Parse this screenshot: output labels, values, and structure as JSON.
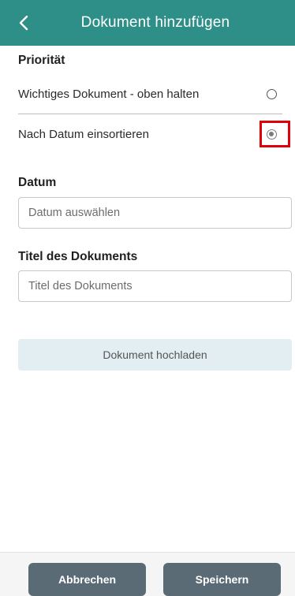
{
  "header": {
    "title": "Dokument hinzufügen",
    "back_icon": "chevron-left-icon",
    "background_color": "#2e8f89"
  },
  "priority": {
    "title": "Priorität",
    "options": [
      {
        "label": "Wichtiges Dokument - oben halten",
        "selected": false
      },
      {
        "label": "Nach Datum einsortieren",
        "selected": true
      }
    ]
  },
  "date": {
    "title": "Datum",
    "placeholder": "Datum auswählen"
  },
  "document_title": {
    "title": "Titel des Dokuments",
    "placeholder": "Titel des Dokuments"
  },
  "upload": {
    "label": "Dokument hochladen"
  },
  "footer": {
    "cancel_label": "Abbrechen",
    "save_label": "Speichern",
    "button_color": "#5a6b76"
  },
  "highlight_color": "#e0000a"
}
